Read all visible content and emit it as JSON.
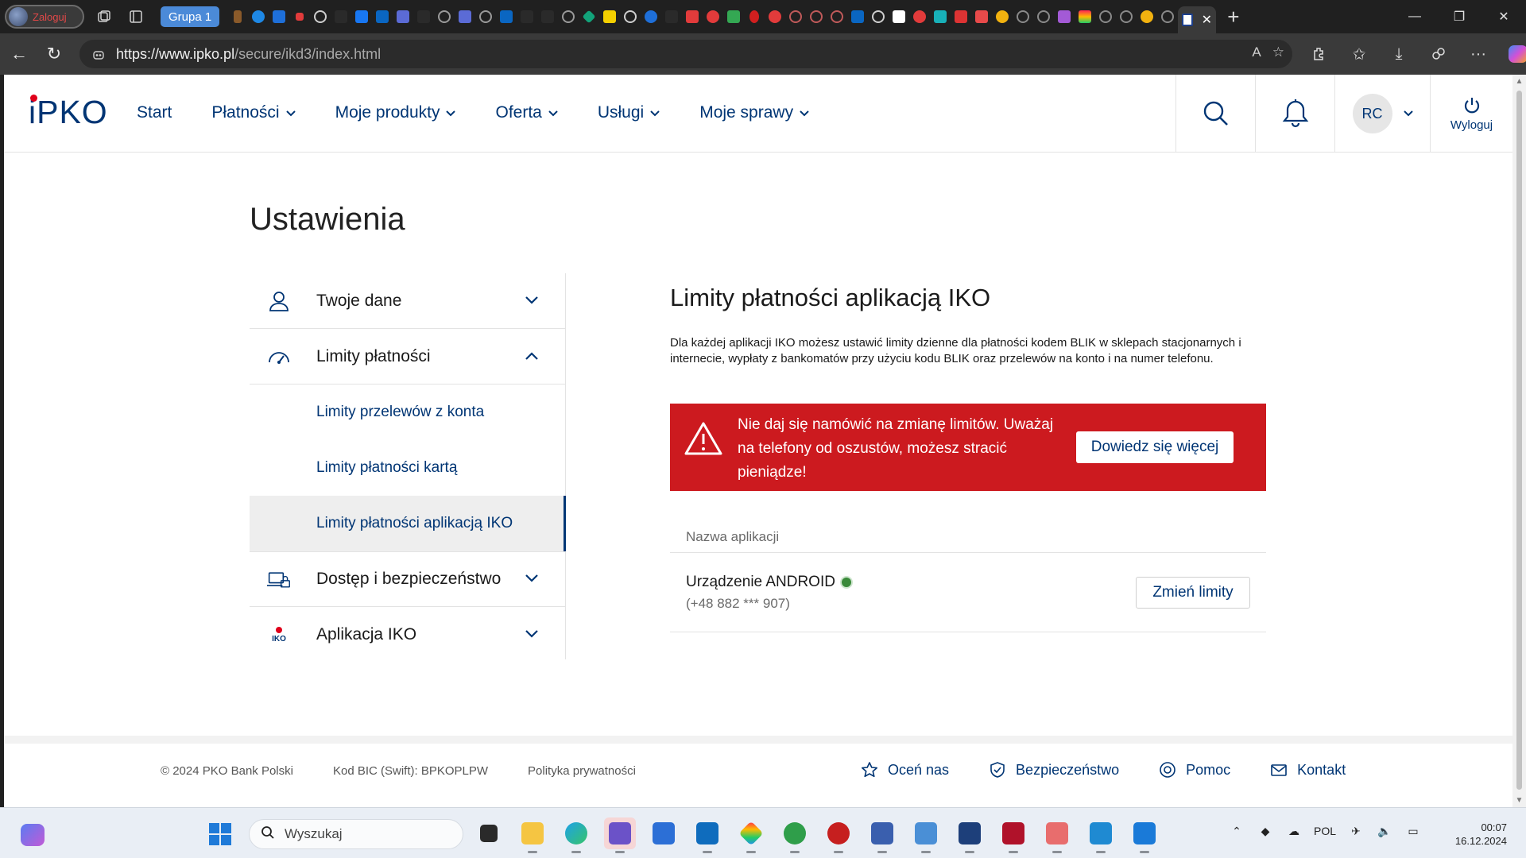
{
  "browser": {
    "profile_label": "Zaloguj",
    "tab_group_label": "Grupa 1",
    "url_host": "https://www.ipko.pl",
    "url_path": "/secure/ikd3/index.html"
  },
  "site": {
    "logo_i": "i",
    "logo_rest": "PKO",
    "menu": [
      {
        "label": "Start",
        "has_dropdown": false
      },
      {
        "label": "Płatności",
        "has_dropdown": true
      },
      {
        "label": "Moje produkty",
        "has_dropdown": true
      },
      {
        "label": "Oferta",
        "has_dropdown": true
      },
      {
        "label": "Usługi",
        "has_dropdown": true
      },
      {
        "label": "Moje sprawy",
        "has_dropdown": true
      }
    ],
    "user_initials": "RC",
    "logout_label": "Wyloguj"
  },
  "settings": {
    "page_title": "Ustawienia",
    "sections": [
      {
        "label": "Twoje dane",
        "icon": "user-icon",
        "expanded": false
      },
      {
        "label": "Limity płatności",
        "icon": "speedometer-icon",
        "expanded": true
      },
      {
        "label": "Dostęp i bezpieczeństwo",
        "icon": "laptop-lock-icon",
        "expanded": false
      },
      {
        "label": "Aplikacja IKO",
        "icon": "iko-icon",
        "expanded": false
      }
    ],
    "sub_items": [
      {
        "label": "Limity przelewów z konta"
      },
      {
        "label": "Limity płatności kartą"
      },
      {
        "label": "Limity płatności aplikacją IKO",
        "active": true
      }
    ],
    "iko_badge": "IKO"
  },
  "content": {
    "title": "Limity płatności aplikacją IKO",
    "description": "Dla każdej aplikacji IKO możesz ustawić limity dzienne dla płatności kodem BLIK w sklepach stacjonarnych i internecie, wypłaty z bankomatów przy użyciu kodu BLIK oraz przelewów na konto i na numer telefonu.",
    "alert_text": "Nie daj się namówić na zmianę limitów. Uważaj na telefony od oszustów, możesz stracić pieniądze!",
    "alert_button": "Dowiedz się więcej",
    "table_header": "Nazwa aplikacji",
    "device_name": "Urządzenie ANDROID",
    "device_phone": "(+48 882 *** 907)",
    "device_status": "active",
    "change_button": "Zmień limity"
  },
  "footer": {
    "copyright": "© 2024 PKO Bank Polski",
    "bic": "Kod BIC (Swift): BPKOPLPW",
    "privacy": "Polityka prywatności",
    "links": [
      "Oceń nas",
      "Bezpieczeństwo",
      "Pomoc",
      "Kontakt"
    ]
  },
  "taskbar": {
    "search_placeholder": "Wyszukaj",
    "language": "POL",
    "time": "00:07",
    "date": "16.12.2024"
  },
  "colors": {
    "brand_navy": "#003574",
    "brand_red": "#e0001a",
    "alert_red": "#cc1a1f",
    "status_green": "#3a8a3a"
  }
}
